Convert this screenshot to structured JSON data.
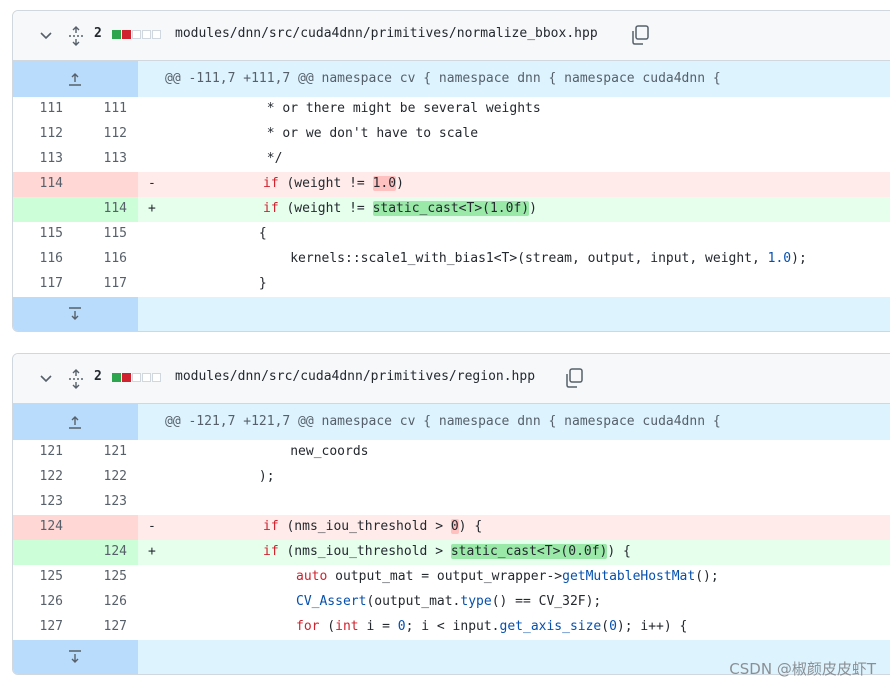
{
  "files": [
    {
      "changes": "2",
      "path": "modules/dnn/src/cuda4dnn/primitives/normalize_bbox.hpp",
      "hunk": "@@ -111,7 +111,7 @@ namespace cv { namespace dnn { namespace cuda4dnn {",
      "lines": [
        {
          "old": "111",
          "new": "111",
          "sign": "",
          "pre": "             * or there might be several weights"
        },
        {
          "old": "112",
          "new": "112",
          "sign": "",
          "pre": "             * or we don't have to scale"
        },
        {
          "old": "113",
          "new": "113",
          "sign": "",
          "pre": "             */"
        },
        {
          "old": "114",
          "new": "",
          "sign": "-",
          "kw": "if",
          "pre": " (weight != ",
          "hl": "1.0",
          "post": ")"
        },
        {
          "old": "",
          "new": "114",
          "sign": "+",
          "kw": "if",
          "pre": " (weight != ",
          "hl": "static_cast<T>(1.0f)",
          "post": ")"
        },
        {
          "old": "115",
          "new": "115",
          "sign": "",
          "pre": "            {"
        },
        {
          "old": "116",
          "new": "116",
          "sign": "",
          "pre": "                kernels::scale1_with_bias1<T>(stream, output, input, weight, ",
          "num": "1.0",
          "post": ");"
        },
        {
          "old": "117",
          "new": "117",
          "sign": "",
          "pre": "            }"
        }
      ]
    },
    {
      "changes": "2",
      "path": "modules/dnn/src/cuda4dnn/primitives/region.hpp",
      "hunk": "@@ -121,7 +121,7 @@ namespace cv { namespace dnn { namespace cuda4dnn {",
      "lines": [
        {
          "old": "121",
          "new": "121",
          "sign": "",
          "pre": "                new_coords"
        },
        {
          "old": "122",
          "new": "122",
          "sign": "",
          "pre": "            );"
        },
        {
          "old": "123",
          "new": "123",
          "sign": "",
          "pre": ""
        },
        {
          "old": "124",
          "new": "",
          "sign": "-",
          "kw": "if",
          "pre": " (nms_iou_threshold > ",
          "hl": "0",
          "post": ") {"
        },
        {
          "old": "",
          "new": "124",
          "sign": "+",
          "kw": "if",
          "pre": " (nms_iou_threshold > ",
          "hl": "static_cast<T>(0.0f)",
          "post": ") {"
        },
        {
          "old": "125",
          "new": "125",
          "sign": "",
          "kw2": "auto",
          "pre": " output_mat = output_wrapper->",
          "fn": "getMutableHostMat",
          "post": "();"
        },
        {
          "old": "126",
          "new": "126",
          "sign": "",
          "fn1": "CV_Assert",
          "pre": "(output_mat.",
          "fn": "type",
          "post": "() == CV_32F);"
        },
        {
          "old": "127",
          "new": "127",
          "sign": "",
          "kw2": "for",
          "pre": " (",
          "kw3": "int",
          "mid": " i = ",
          "num": "0",
          "post": "; i < input.",
          "fn": "get_axis_size",
          "post2": "(",
          "num2": "0",
          "post3": "); i++) {"
        }
      ]
    }
  ],
  "watermark": "CSDN @椒颜皮皮虾T"
}
